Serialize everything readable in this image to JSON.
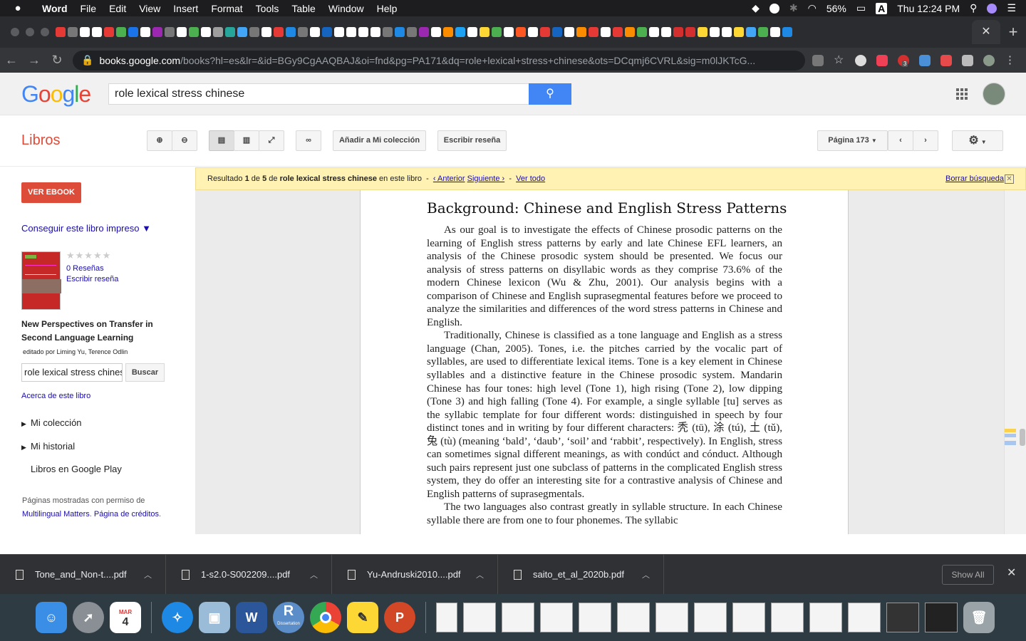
{
  "menubar": {
    "app": "Word",
    "items": [
      "File",
      "Edit",
      "View",
      "Insert",
      "Format",
      "Tools",
      "Table",
      "Window",
      "Help"
    ],
    "battery": "56%",
    "clock": "Thu 12:24 PM",
    "input_source": "A"
  },
  "browser": {
    "url_host": "books.google.com",
    "url_path": "/books?hl=es&lr=&id=BGy9CgAAQBAJ&oi=fnd&pg=PA171&dq=role+lexical+stress+chinese&ots=DCqmj6CVRL&sig=m0lJKTcG...",
    "extension_badge": "3"
  },
  "google": {
    "logo": "Google",
    "search_value": "role lexical stress chinese"
  },
  "toolbar": {
    "section": "Libros",
    "add_collection": "Añadir a Mi colección",
    "write_review": "Escribir reseña",
    "page_select": "Página 173"
  },
  "left": {
    "ebook_button": "VER EBOOK",
    "get_print": "Conseguir este libro impreso ▼",
    "reviews": "0 Reseñas",
    "write_review": "Escribir reseña",
    "book_title": "New Perspectives on Transfer in Second Language Learning",
    "byline": "editado por Liming Yu, Terence Odlin",
    "search_value": "role lexical stress chinese",
    "search_button": "Buscar",
    "about": "Acerca de este libro",
    "my_collection": "Mi colección",
    "my_history": "Mi historial",
    "play": "Libros en Google Play",
    "permission_text": "Páginas mostradas con permiso de",
    "publisher": "Multilingual Matters",
    "credits": "Página de créditos"
  },
  "result": {
    "prefix": "Resultado",
    "num": "1",
    "of": "de",
    "total": "5",
    "de": "de",
    "query": "role lexical stress chinese",
    "suffix": "en este libro",
    "sep1": "-",
    "prev": "‹ Anterior",
    "next": "Siguiente ›",
    "sep2": "-",
    "all": "Ver todo",
    "clear": "Borrar búsqueda"
  },
  "page": {
    "title": "Background: Chinese and English Stress Patterns",
    "paragraphs": [
      "As our goal is to investigate the effects of Chinese prosodic patterns on the learning of English stress patterns by early and late Chinese EFL learners, an analysis of the Chinese prosodic system should be presented. We focus our analysis of stress patterns on disyllabic words as they comprise 73.6% of the modern Chinese lexicon (Wu & Zhu, 2001). Our analysis begins with a comparison of Chinese and English suprasegmental features before we proceed to analyze the similarities and differences of the word stress patterns in Chinese and English.",
      "Traditionally, Chinese is classified as a tone language and English as a stress language (Chan, 2005). Tones, i.e. the pitches carried by the vocalic part of syllables, are used to differentiate lexical items. Tone is a key element in Chinese syllables and a distinctive feature in the Chinese prosodic system. Mandarin Chinese has four tones: high level (Tone 1), high rising (Tone 2), low dipping (Tone 3) and high falling (Tone 4). For example, a single syllable [tu] serves as the syllabic template for four different words: distinguished in speech by four distinct tones and in writing by four different characters: 秃 (tū), 涂 (tú), 土 (tǔ), 兔 (tù) (meaning ‘bald’, ‘daub’, ‘soil’ and ‘rabbit’, respectively). In English, stress can sometimes signal different meanings, as with condúct and cónduct. Although such pairs represent just one subclass of patterns in the complicated English stress system, they do offer an interesting site for a contrastive analysis of Chinese and English patterns of suprasegmentals.",
      "The two languages also contrast greatly in syllable structure. In each Chinese syllable there are from one to four phonemes. The syllabic"
    ]
  },
  "downloads": {
    "files": [
      "Tone_and_Non-t....pdf",
      "1-s2.0-S002209....pdf",
      "Yu-Andruski2010....pdf",
      "saito_et_al_2020b.pdf"
    ],
    "show_all": "Show All"
  },
  "dock": {
    "calendar_month": "MAR",
    "calendar_day": "4",
    "r_label": "Dissertation"
  }
}
